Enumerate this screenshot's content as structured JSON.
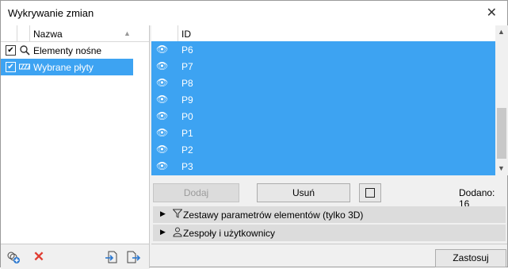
{
  "window": {
    "title": "Wykrywanie zmian",
    "close_icon": "close-icon"
  },
  "left_panel": {
    "column_header": "Nazwa",
    "items": [
      {
        "label": "Elementy nośne",
        "checked": true,
        "icon": "magnifier-icon"
      },
      {
        "label": "Wybrane płyty",
        "checked": true,
        "icon": "slab-hatch-icon",
        "selected": true
      }
    ],
    "footer_icons": [
      "add-set-icon",
      "delete-icon",
      "import-icon",
      "export-icon"
    ]
  },
  "list": {
    "column_header": "ID",
    "rows": [
      "P6",
      "P7",
      "P8",
      "P9",
      "P0",
      "P1",
      "P2",
      "P3"
    ],
    "row_icon": "eye-icon"
  },
  "actions": {
    "add_label": "Dodaj",
    "remove_label": "Usuń",
    "added_text": "Dodano: 16"
  },
  "sections": [
    {
      "label": "Zestawy parametrów elementów (tylko 3D)",
      "icon": "filter-icon"
    },
    {
      "label": "Zespoły i użytkownicy",
      "icon": "user-icon"
    }
  ],
  "apply_label": "Zastosuj",
  "colors": {
    "selection": "#3da3f2",
    "panel_bg": "#f0f0f0",
    "delete_red": "#e03c31"
  }
}
